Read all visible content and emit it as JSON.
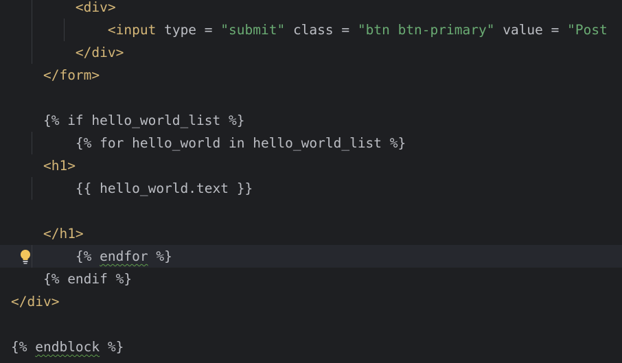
{
  "editor": {
    "lines": [
      {
        "indent": "        ",
        "tokens": [
          {
            "t": "<div>",
            "c": "tag"
          }
        ]
      },
      {
        "indent": "            ",
        "tokens": [
          {
            "t": "<input",
            "c": "tag"
          },
          {
            "t": " type ",
            "c": "attr"
          },
          {
            "t": "= ",
            "c": "attr"
          },
          {
            "t": "\"submit\"",
            "c": "str"
          },
          {
            "t": " class ",
            "c": "attr"
          },
          {
            "t": "= ",
            "c": "attr"
          },
          {
            "t": "\"btn btn-primary\"",
            "c": "str"
          },
          {
            "t": " value ",
            "c": "attr"
          },
          {
            "t": "= ",
            "c": "attr"
          },
          {
            "t": "\"Post",
            "c": "str"
          }
        ]
      },
      {
        "indent": "        ",
        "tokens": [
          {
            "t": "</div>",
            "c": "tag"
          }
        ]
      },
      {
        "indent": "    ",
        "tokens": [
          {
            "t": "</form>",
            "c": "tag"
          }
        ]
      },
      {
        "indent": "",
        "tokens": []
      },
      {
        "indent": "    ",
        "tokens": [
          {
            "t": "{% if hello_world_list %}",
            "c": "tpl"
          }
        ]
      },
      {
        "indent": "        ",
        "tokens": [
          {
            "t": "{% for hello_world in hello_world_list %}",
            "c": "tpl"
          }
        ]
      },
      {
        "indent": "    ",
        "tokens": [
          {
            "t": "<h1>",
            "c": "tag"
          }
        ]
      },
      {
        "indent": "        ",
        "tokens": [
          {
            "t": "{{ hello_world.text }}",
            "c": "tpl"
          }
        ]
      },
      {
        "indent": "",
        "tokens": []
      },
      {
        "indent": "    ",
        "tokens": [
          {
            "t": "</h1>",
            "c": "tag"
          }
        ]
      },
      {
        "indent": "        ",
        "current": true,
        "bulb": true,
        "tokens": [
          {
            "t": "{% ",
            "c": "tpl"
          },
          {
            "t": "endfor",
            "c": "tpl squiggle"
          },
          {
            "t": " %}",
            "c": "tpl"
          }
        ]
      },
      {
        "indent": "    ",
        "tokens": [
          {
            "t": "{% endif %}",
            "c": "tpl"
          }
        ]
      },
      {
        "indent": "",
        "tokens": [
          {
            "t": "</div>",
            "c": "tag"
          }
        ]
      },
      {
        "indent": "",
        "tokens": []
      },
      {
        "indent": "",
        "tokens": [
          {
            "t": "{% ",
            "c": "tpl"
          },
          {
            "t": "endblock",
            "c": "tpl squiggle"
          },
          {
            "t": " %}",
            "c": "tpl"
          }
        ]
      }
    ],
    "guides": [
      [
        0,
        1,
        2
      ],
      [
        1
      ],
      [],
      [],
      [],
      [
        6
      ],
      [],
      [
        8
      ],
      [
        8
      ],
      [],
      [],
      [
        11
      ],
      [],
      [],
      [],
      []
    ],
    "colors": {
      "background": "#1e1f22",
      "current_line": "#26282e",
      "tag": "#d5b778",
      "string": "#6aab73",
      "text": "#bcbec4",
      "indent_guide": "#393b40",
      "bulb": "#f2c55c"
    },
    "icons": {
      "intention": "lightbulb-icon"
    }
  }
}
